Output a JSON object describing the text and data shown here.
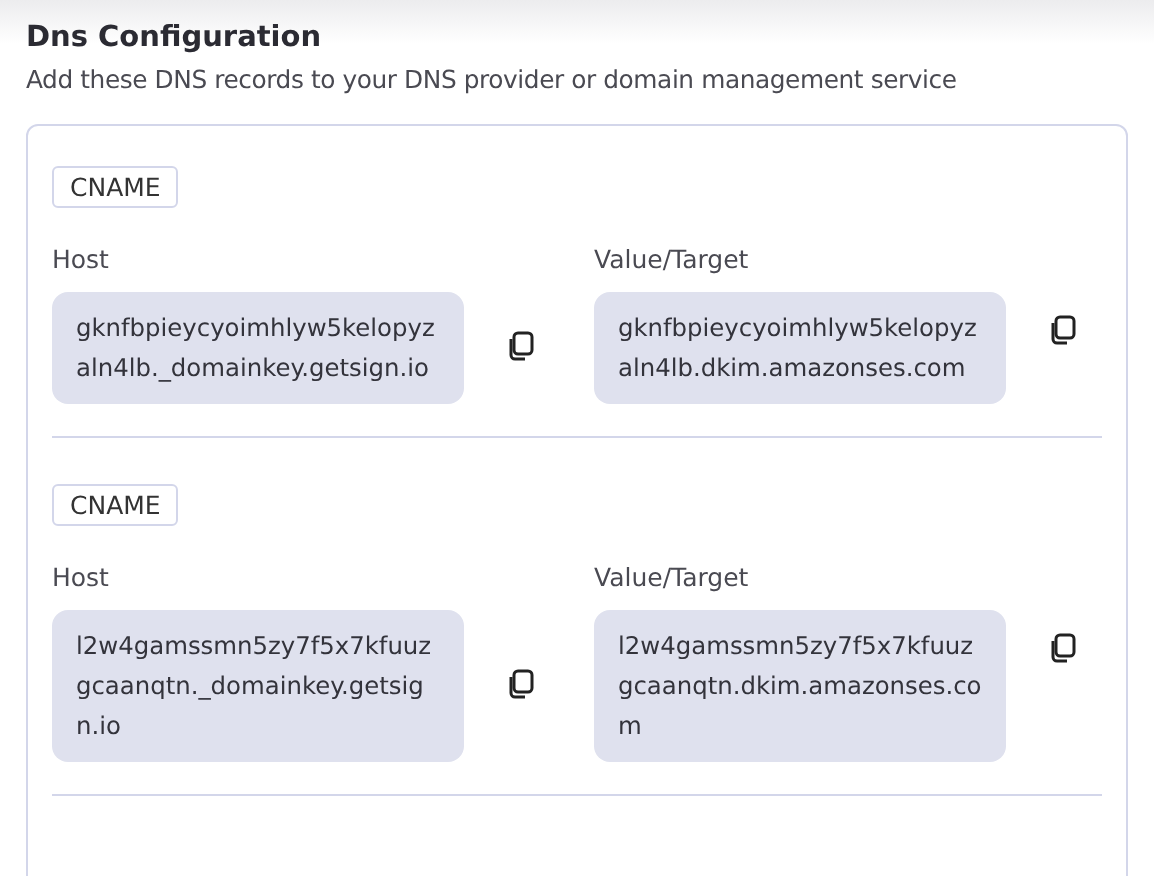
{
  "title": "Dns Configuration",
  "subtitle": "Add these DNS records to your DNS provider or domain management service",
  "records": [
    {
      "type": "CNAME",
      "host_label": "Host",
      "host": "gknfbpieycyoimhlyw5kelopyzaln4lb._domainkey.getsign.io",
      "value_label": "Value/Target",
      "value": "gknfbpieycyoimhlyw5kelopyzaln4lb.dkim.amazonses.com"
    },
    {
      "type": "CNAME",
      "host_label": "Host",
      "host": "l2w4gamssmn5zy7f5x7kfuuzgcaanqtn._domainkey.getsign.io",
      "value_label": "Value/Target",
      "value": "l2w4gamssmn5zy7f5x7kfuuzgcaanqtn.dkim.amazonses.com"
    }
  ]
}
